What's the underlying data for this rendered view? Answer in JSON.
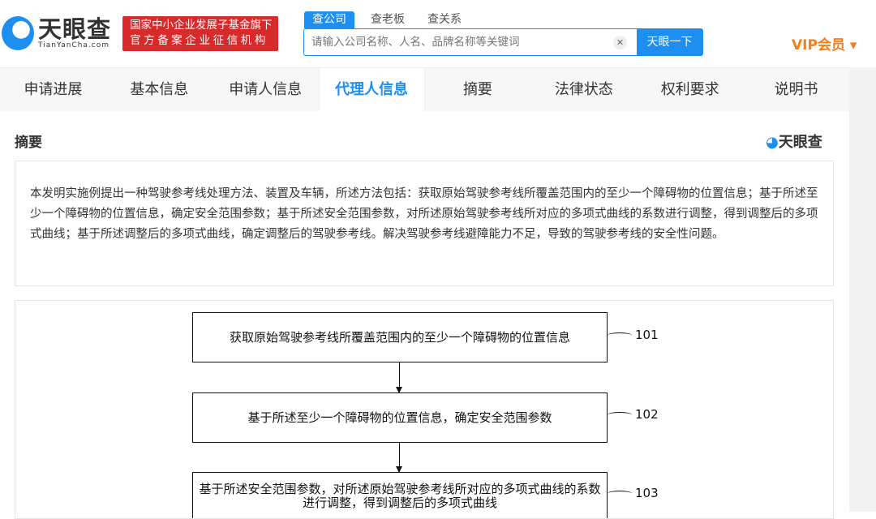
{
  "header": {
    "logo_cn": "天眼查",
    "logo_en": "TianYanCha.com",
    "badge_line1": "国家中小企业发展子基金旗下",
    "badge_line2": "官方备案企业征信机构",
    "search_tabs": [
      "查公司",
      "查老板",
      "查关系"
    ],
    "search_placeholder": "请输入公司名称、人名、品牌名称等关键词",
    "search_button": "天眼一下",
    "vip": "VIP会员 ▾"
  },
  "nav": {
    "items": [
      "申请进展",
      "基本信息",
      "申请人信息",
      "代理人信息",
      "摘要",
      "法律状态",
      "权利要求",
      "说明书"
    ],
    "active": 3
  },
  "section": {
    "title": "摘要",
    "logo": "天眼查",
    "abstract": "本发明实施例提出一种驾驶参考线处理方法、装置及车辆，所述方法包括：获取原始驾驶参考线所覆盖范围内的至少一个障碍物的位置信息；基于所述至少一个障碍物的位置信息，确定安全范围参数；基于所述安全范围参数，对所述原始驾驶参考线所对应的多项式曲线的系数进行调整，得到调整后的多项式曲线；基于所述调整后的多项式曲线，确定调整后的驾驶参考线。解决驾驶参考线避障能力不足，导致的驾驶参考线的安全性问题。"
  },
  "figure": {
    "steps": [
      {
        "text": "获取原始驾驶参考线所覆盖范围内的至少一个障碍物的位置信息",
        "label": "101"
      },
      {
        "text": "基于所述至少一个障碍物的位置信息，确定安全范围参数",
        "label": "102"
      },
      {
        "text": "基于所述安全范围参数，对所述原始驾驶参考线所对应的多项式曲线的系数进行调整，得到调整后的多项式曲线",
        "label": "103"
      }
    ]
  }
}
